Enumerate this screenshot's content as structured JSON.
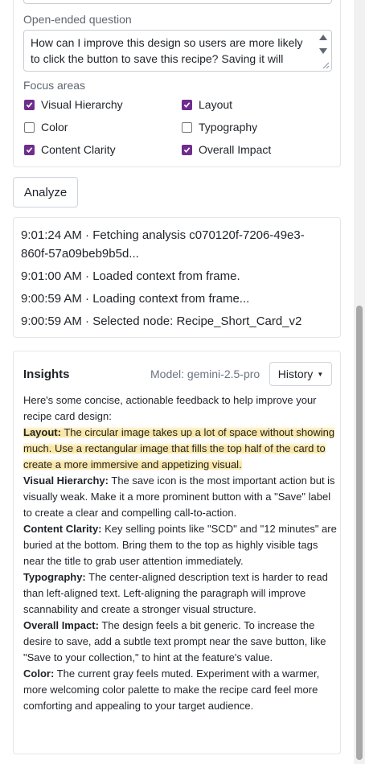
{
  "form": {
    "open_ended_label": "Open-ended question",
    "question_value": "How can I improve this design so users are more likely to click the button to save this recipe? Saving it will",
    "focus_label": "Focus areas",
    "focus_areas": [
      {
        "label": "Visual Hierarchy",
        "checked": true
      },
      {
        "label": "Layout",
        "checked": true
      },
      {
        "label": "Color",
        "checked": false
      },
      {
        "label": "Typography",
        "checked": false
      },
      {
        "label": "Content Clarity",
        "checked": true
      },
      {
        "label": "Overall Impact",
        "checked": true
      }
    ]
  },
  "analyze_label": "Analyze",
  "log": [
    "9:01:24 AM · Fetching analysis c070120f-7206-49e3-860f-57a09beb9b5d...",
    "9:01:00 AM · Loaded context from frame.",
    "9:00:59 AM · Loading context from frame...",
    "9:00:59 AM · Selected node: Recipe_Short_Card_v2"
  ],
  "insights": {
    "title": "Insights",
    "model": "Model: gemini-2.5-pro",
    "history_label": "History",
    "intro": "Here's some concise, actionable feedback to help improve your recipe card design:",
    "items": [
      {
        "label": "Layout:",
        "text": "The circular image takes up a lot of space without showing much. Use a rectangular image that fills the top half of the card to create a more immersive and appetizing visual.",
        "highlighted": true
      },
      {
        "label": "Visual Hierarchy:",
        "text": "The save icon is the most important action but is visually weak. Make it a more prominent button with a \"Save\" label to create a clear and compelling call-to-action.",
        "highlighted": false
      },
      {
        "label": "Content Clarity:",
        "text": "Key selling points like \"SCD\" and \"12 minutes\" are buried at the bottom. Bring them to the top as highly visible tags near the title to grab user attention immediately.",
        "highlighted": false
      },
      {
        "label": "Typography:",
        "text": "The center-aligned description text is harder to read than left-aligned text. Left-aligning the paragraph will improve scannability and create a stronger visual structure.",
        "highlighted": false
      },
      {
        "label": "Overall Impact:",
        "text": "The design feels a bit generic. To increase the desire to save, add a subtle text prompt near the save button, like \"Save to your collection,\" to hint at the feature's value.",
        "highlighted": false
      },
      {
        "label": "Color:",
        "text": "The current gray feels muted. Experiment with a warmer, more welcoming color palette to make the recipe card feel more comforting and appealing to your target audience.",
        "highlighted": false
      }
    ]
  },
  "colors": {
    "checkbox_accent": "#6f2d8c",
    "highlight": "#fbe7a6"
  }
}
